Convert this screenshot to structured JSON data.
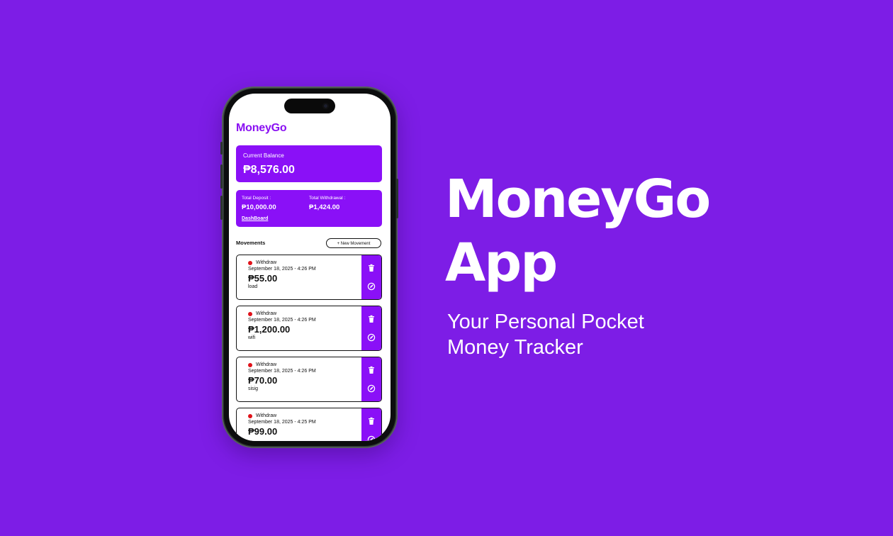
{
  "colors": {
    "background": "#7d1de6",
    "accent": "#8a10f7",
    "withdraw_dot": "#e0121a"
  },
  "app": {
    "title": "MoneyGo",
    "balance": {
      "label": "Current Balance",
      "value": "₱8,576.00"
    },
    "summary": {
      "deposit_label": "Total Deposit :",
      "deposit_value": "₱10,000.00",
      "withdrawal_label": "Total Withdrawal :",
      "withdrawal_value": "₱1,424.00",
      "dashboard_link": "DashBoard"
    },
    "movements_heading": "Movements",
    "new_movement_button": "+ New Movement",
    "movements": [
      {
        "type": "Withdraw",
        "date": "September 18, 2025 - 4:26 PM",
        "amount": "₱55.00",
        "note": "load"
      },
      {
        "type": "Withdraw",
        "date": "September 18, 2025 - 4:26 PM",
        "amount": "₱1,200.00",
        "note": "wifi"
      },
      {
        "type": "Withdraw",
        "date": "September 18, 2025 - 4:26 PM",
        "amount": "₱70.00",
        "note": "sisig"
      },
      {
        "type": "Withdraw",
        "date": "September 18, 2025 - 4:25 PM",
        "amount": "₱99.00",
        "note": ""
      }
    ],
    "action_icons": [
      "trash-icon",
      "edit-icon"
    ]
  },
  "hero": {
    "title_line1": "MoneyGo",
    "title_line2": "App",
    "subtitle_line1": "Your Personal Pocket",
    "subtitle_line2": "Money Tracker"
  }
}
